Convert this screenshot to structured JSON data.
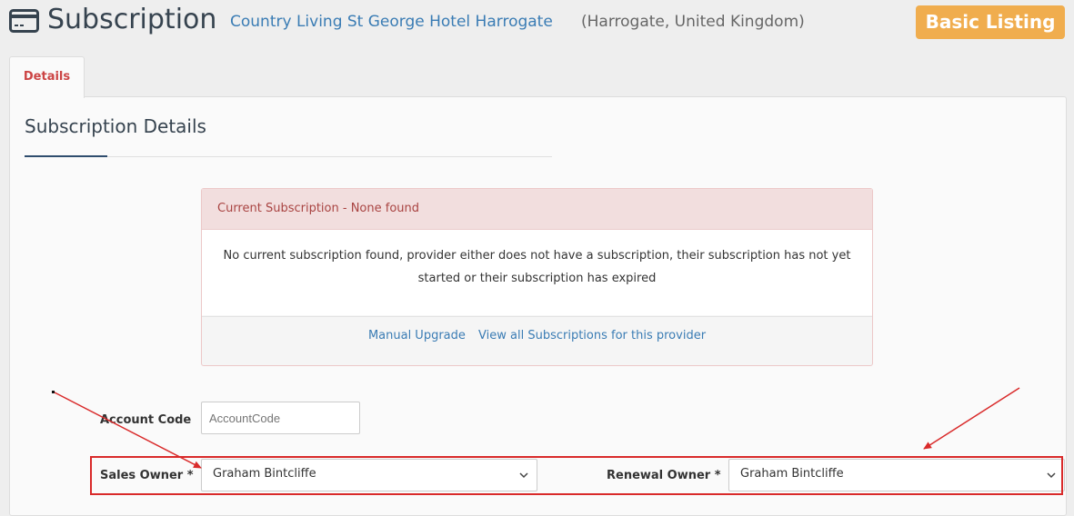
{
  "header": {
    "icon": "credit-card-icon",
    "title": "Subscription",
    "hotel_name": "Country Living St George Hotel Harrogate",
    "hotel_location": "(Harrogate, United Kingdom)",
    "badge": "Basic Listing"
  },
  "tabs": [
    {
      "label": "Details",
      "active": true
    }
  ],
  "section": {
    "title": "Subscription Details"
  },
  "alert": {
    "heading": "Current Subscription - None found",
    "message_line1": "No current subscription found, provider either does not have a subscription, their subscription has not yet",
    "message_line2": "started or their subscription has expired",
    "link_manual_upgrade": "Manual Upgrade",
    "link_view_all": "View all Subscriptions for this provider"
  },
  "form": {
    "account_code_label": "Account Code",
    "account_code_placeholder": "AccountCode",
    "account_code_value": "",
    "sales_owner_label": "Sales Owner *",
    "sales_owner_value": "Graham Bintcliffe",
    "renewal_owner_label": "Renewal Owner *",
    "renewal_owner_value": "Graham Bintcliffe"
  },
  "colors": {
    "badge": "#f0ad4e",
    "link": "#3a7cb4",
    "alert_heading": "#a94442",
    "highlight": "#d92a2a"
  }
}
